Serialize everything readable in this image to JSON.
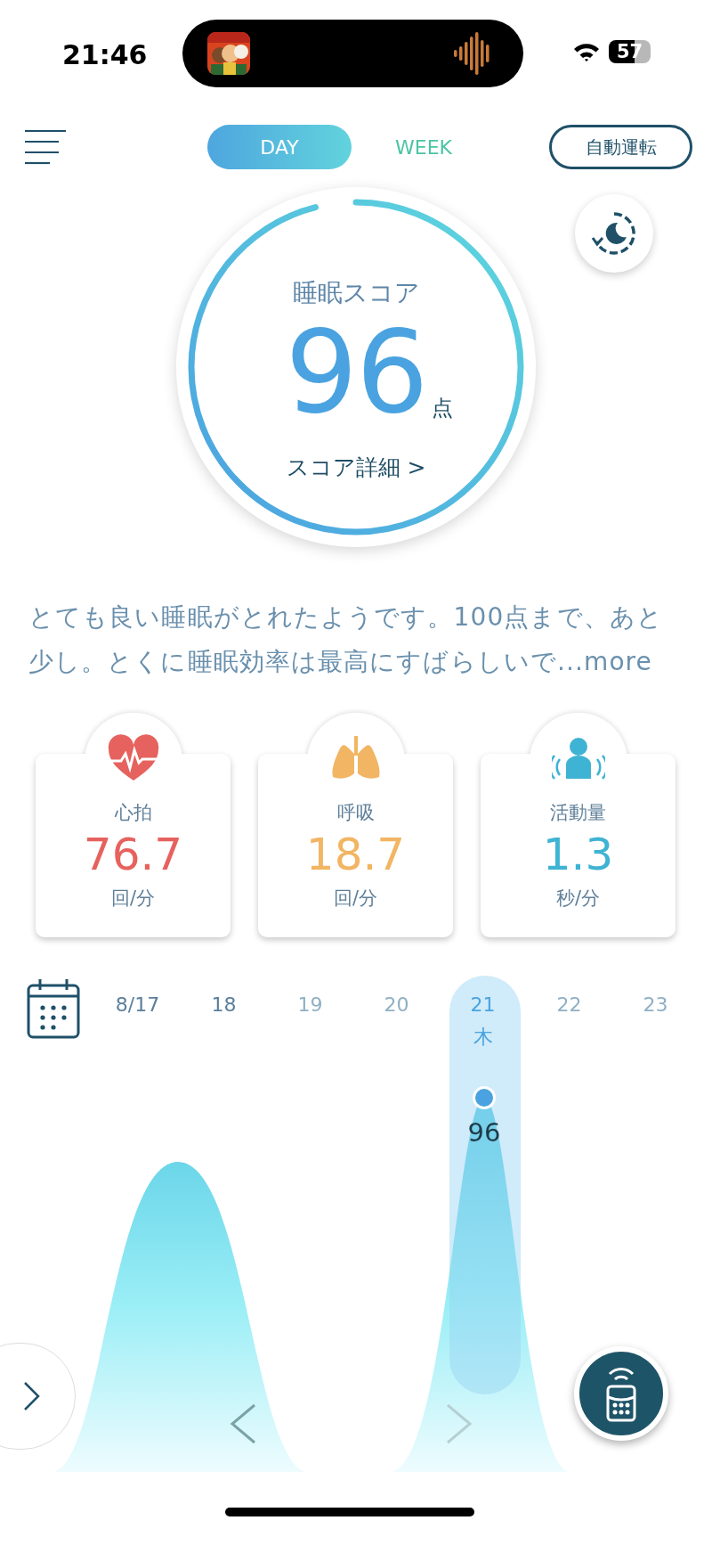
{
  "status_bar": {
    "time": "21:46",
    "battery": "57"
  },
  "header": {
    "tabs": [
      {
        "label": "DAY",
        "selected": true
      },
      {
        "label": "WEEK",
        "selected": false
      }
    ],
    "auto_button": "自動運転"
  },
  "score": {
    "title": "睡眠スコア",
    "value": "96",
    "unit": "点",
    "level": 0.96,
    "detail_link": "スコア詳細 >"
  },
  "summary": {
    "text": "とても良い睡眠がとれたようです。100点まで、あと少し。とくに睡眠効率は最高にすばらしいで",
    "more": "...more"
  },
  "metrics": [
    {
      "kind": "heart",
      "label": "心拍",
      "value": "76.7",
      "unit": "回/分",
      "color": "#e6625e"
    },
    {
      "kind": "lungs",
      "label": "呼吸",
      "value": "18.7",
      "unit": "回/分",
      "color": "#f2b563"
    },
    {
      "kind": "activity",
      "label": "活動量",
      "value": "1.3",
      "unit": "秒/分",
      "color": "#3fb3d3"
    }
  ],
  "chart": {
    "days": [
      {
        "label": "8/17",
        "dimmed": false,
        "selected": false
      },
      {
        "label": "18",
        "dimmed": false,
        "selected": false
      },
      {
        "label": "19",
        "dimmed": true,
        "selected": false
      },
      {
        "label": "20",
        "dimmed": true,
        "selected": false
      },
      {
        "label": "21",
        "weekday": "木",
        "selected": true
      },
      {
        "label": "22",
        "dimmed": true,
        "selected": false
      },
      {
        "label": "23",
        "dimmed": true,
        "selected": false
      }
    ],
    "point_label": "96"
  }
}
